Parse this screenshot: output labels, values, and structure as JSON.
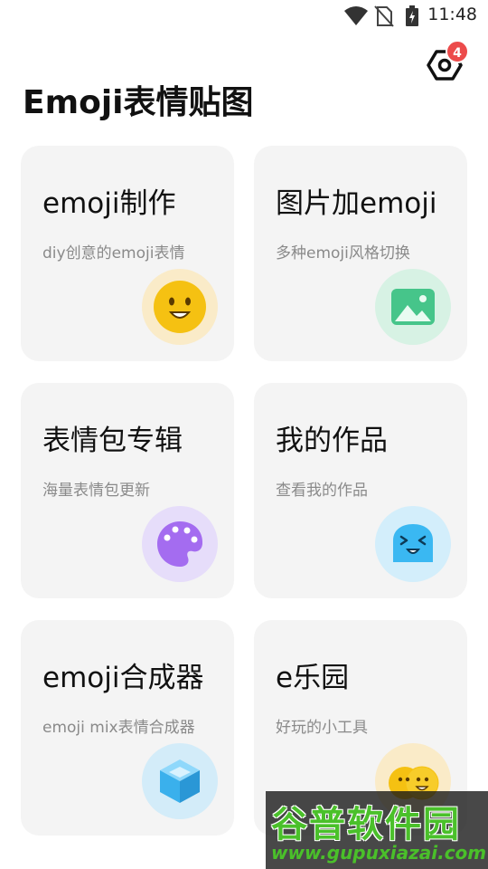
{
  "status_bar": {
    "time": "11:48",
    "icons": [
      "wifi-icon",
      "no-sim-icon",
      "battery-charging-icon"
    ]
  },
  "header": {
    "title": "Emoji表情贴图",
    "settings_icon": "settings-icon",
    "settings_badge": "4"
  },
  "cards": [
    {
      "title": "emoji制作",
      "subtitle": "diy创意的emoji表情",
      "icon": "smiley-face-icon",
      "accent": "#f7c81e"
    },
    {
      "title": "图片加emoji",
      "subtitle": "多种emoji风格切换",
      "icon": "image-icon",
      "accent": "#46c58a"
    },
    {
      "title": "表情包专辑",
      "subtitle": "海量表情包更新",
      "icon": "palette-icon",
      "accent": "#a46cf0"
    },
    {
      "title": "我的作品",
      "subtitle": "查看我的作品",
      "icon": "ghost-face-icon",
      "accent": "#3ab8f2"
    },
    {
      "title": "emoji合成器",
      "subtitle": "emoji mix表情合成器",
      "icon": "cube-icon",
      "accent": "#3ab0ec"
    },
    {
      "title": "e乐园",
      "subtitle": "好玩的小工具",
      "icon": "double-smiley-icon",
      "accent": "#f7c81e"
    }
  ],
  "watermark": {
    "name": "谷普软件园",
    "url": "www.gupuxiazai.com"
  },
  "colors": {
    "card_bg": "#f4f4f4",
    "badge": "#ec4b4b",
    "watermark_green": "#4ac02a"
  }
}
